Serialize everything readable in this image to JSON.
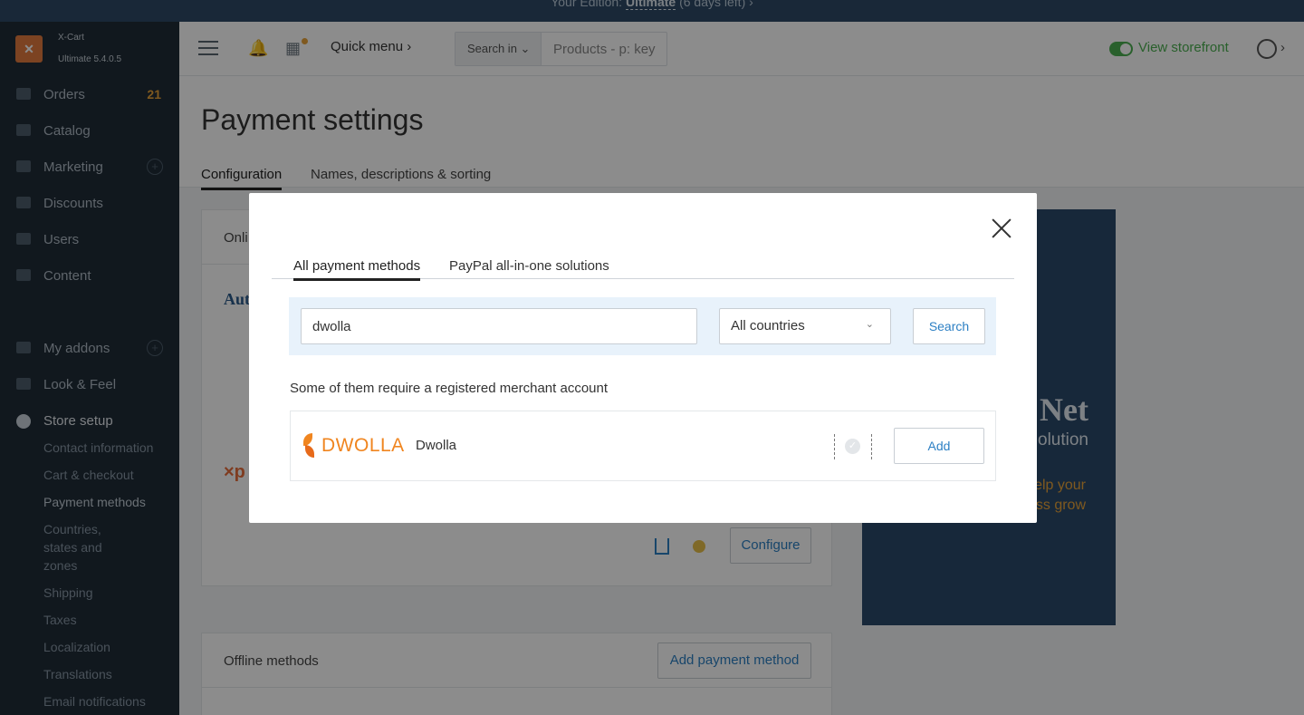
{
  "banner": {
    "prefix": "Your Edition:",
    "edition": "Ultimate",
    "suffix": "(6 days left)",
    "chevron": "›"
  },
  "brand": {
    "logo_glyph": "✕",
    "name": "X-Cart",
    "version": "Ultimate 5.4.0.5"
  },
  "sidebar": {
    "items": [
      {
        "label": "Orders",
        "badge": "21"
      },
      {
        "label": "Catalog"
      },
      {
        "label": "Marketing",
        "plus": "+"
      },
      {
        "label": "Discounts"
      },
      {
        "label": "Users"
      },
      {
        "label": "Content"
      },
      {
        "label": "My addons",
        "plus": "+"
      },
      {
        "label": "Look & Feel"
      },
      {
        "label": "Store setup"
      }
    ],
    "subitems": [
      "Contact information",
      "Cart & checkout",
      "Payment methods",
      "Countries, states and zones",
      "Shipping",
      "Taxes",
      "Localization",
      "Translations",
      "Email notifications"
    ]
  },
  "header": {
    "quick_menu": "Quick menu ›",
    "search_in": "Search in ⌄",
    "search_hint": "Products - p: key",
    "view_storefront": "View storefront",
    "user_chevron": "›"
  },
  "page": {
    "title": "Payment settings",
    "tabs": [
      "Configuration",
      "Names, descriptions & sorting"
    ],
    "online_header": "Onli",
    "aut_fragment": "Aut",
    "xp_fragment": "×p",
    "configure": "Configure",
    "offline_header": "Offline methods",
    "add_payment_method": "Add payment method",
    "banner_net": "Net",
    "banner_solution": "olution",
    "banner_tagline": "yments tools to help your business grow"
  },
  "modal": {
    "tabs": [
      "All payment methods",
      "PayPal all-in-one solutions"
    ],
    "search_value": "dwolla",
    "country": "All countries",
    "search_button": "Search",
    "note": "Some of them require a registered merchant account",
    "result": {
      "logo_text": "DWOLLA",
      "name": "Dwolla",
      "check": "✓",
      "add_button": "Add"
    }
  },
  "colors": {
    "accent": "#2d80c4",
    "storefront": "#4caf50",
    "dwolla": "#f0851f",
    "badge": "#e8a23a"
  }
}
